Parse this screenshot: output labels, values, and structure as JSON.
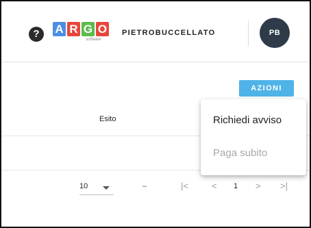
{
  "header": {
    "help_icon_glyph": "?",
    "logo": {
      "letters": [
        "A",
        "R",
        "G",
        "O"
      ],
      "colors": [
        "#4b8fe3",
        "#e8463c",
        "#5bbb4b",
        "#e8463c"
      ],
      "sub": "software"
    },
    "username": "PIETROBUCCELLATO",
    "avatar_initials": "PB"
  },
  "actions": {
    "label": "AZIONI",
    "color": "#4fb3e8"
  },
  "table": {
    "column_header": "Esito"
  },
  "pagination": {
    "rows_per_page": "10",
    "range": "–",
    "first_icon": "|<",
    "prev_icon": "<",
    "page": "1",
    "next_icon": ">",
    "last_icon": ">|"
  },
  "menu": {
    "items": [
      {
        "label": "Richiedi avviso",
        "enabled": true
      },
      {
        "label": "Paga subito",
        "enabled": false
      }
    ]
  }
}
